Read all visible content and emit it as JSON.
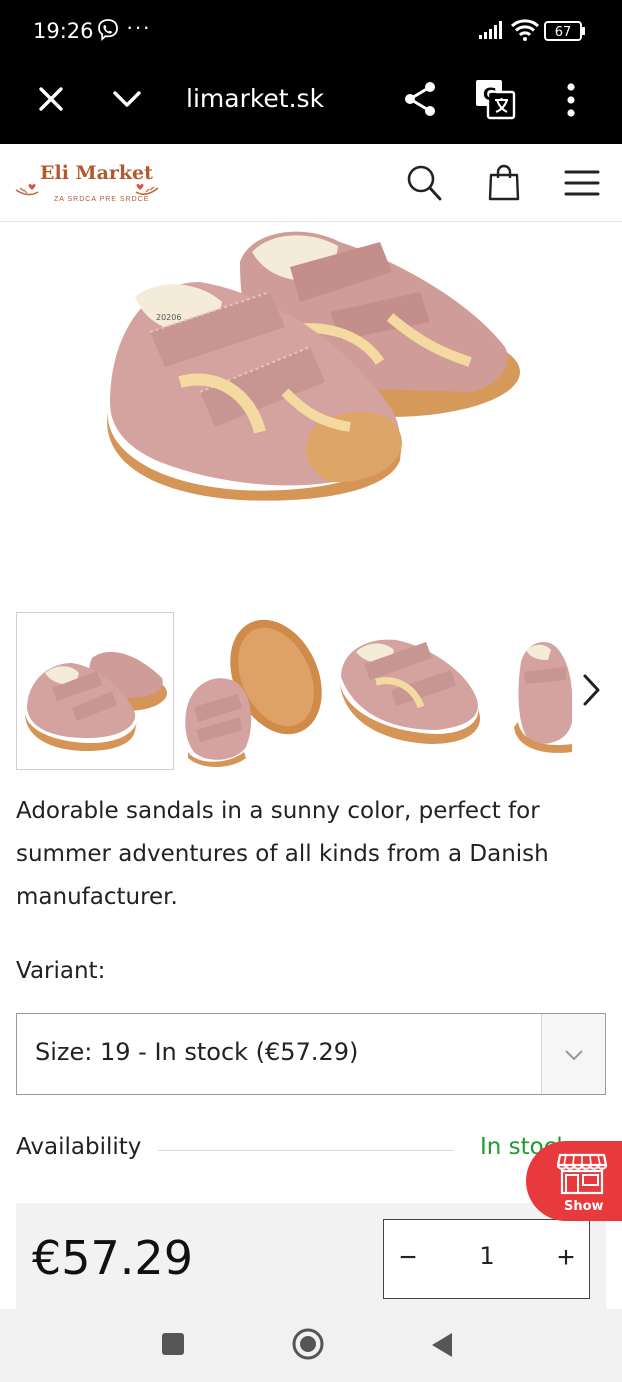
{
  "status_bar": {
    "time": "19:26",
    "overflow": "···",
    "battery": "67",
    "icons": [
      "viber-icon",
      "signal-icon",
      "wifi-icon",
      "battery-icon"
    ]
  },
  "browser": {
    "url": "limarket.sk",
    "icons": [
      "close-icon",
      "chevron-down-icon",
      "share-icon",
      "translate-icon",
      "more-vert-icon"
    ]
  },
  "header": {
    "logo_text": "Eli Market",
    "logo_tagline": "ZA SRDCA PRE SRDCE",
    "brand_color": "#b25a2e",
    "icons": [
      "search-icon",
      "shopping-bag-icon",
      "hamburger-menu-icon"
    ]
  },
  "product": {
    "description": "Adorable sandals in a sunny color, perfect for summer adventures of all kinds from a Danish manufacturer.",
    "variant_label": "Variant:",
    "variant_selected": "Size: 19 - In stock (€57.29)",
    "availability_label": "Availability",
    "availability_value": "In stock",
    "availability_color": "#1f9b2c",
    "price": "€57.29",
    "quantity": "1",
    "qty_minus": "−",
    "qty_plus": "+",
    "thumbnail_count": 4
  },
  "show_button": {
    "label": "Show",
    "color": "#e8393c",
    "icon": "storefront-icon"
  },
  "nav_bar": {
    "icons": [
      "recents-icon",
      "home-icon",
      "back-icon"
    ]
  }
}
